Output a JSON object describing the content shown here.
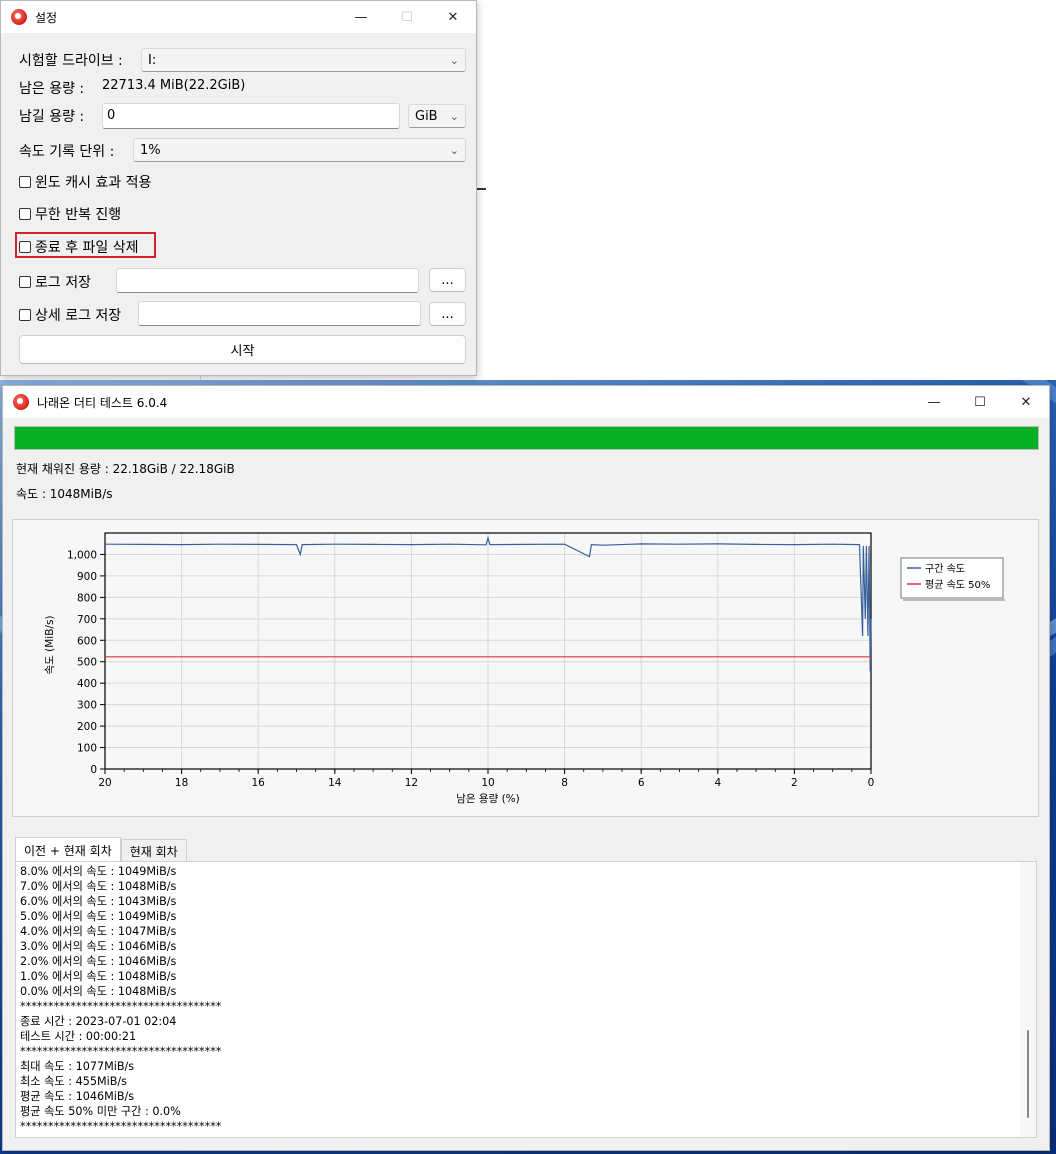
{
  "settings_window": {
    "title": "설정",
    "window_buttons": {
      "minimize": "—",
      "maximize": "☐",
      "close": "✕"
    },
    "drive_label": "시험할 드라이브 :",
    "drive_value": "I:",
    "free_space_label": "남은 용량 :",
    "free_space_value": "22713.4 MiB(22.2GiB)",
    "leave_space_label": "남길 용량 :",
    "leave_space_value": "0",
    "leave_space_unit": "GiB",
    "speed_unit_label": "속도 기록 단위 :",
    "speed_unit_value": "1%",
    "checkboxes": {
      "windows_cache": "윈도 캐시 효과 적용",
      "infinite_loop": "무한 반복 진행",
      "delete_after": "종료 후 파일 삭제",
      "save_log": "로그 저장",
      "save_detail_log": "상세 로그 저장"
    },
    "browse_label": "...",
    "start_label": "시작",
    "highlight_color": "#d6202a"
  },
  "main_window": {
    "title": "나래온 더티 테스트 6.0.4",
    "window_buttons": {
      "minimize": "—",
      "maximize": "☐",
      "close": "✕"
    },
    "progress": 1.0,
    "progress_color": "#06b025",
    "filled_text": "현재 채워진 용량 : 22.18GiB / 22.18GiB",
    "speed_text": "속도 : 1048MiB/s",
    "tabs": [
      "이전 + 현재 회차",
      "현재 회차"
    ],
    "log_lines": [
      "8.0% 에서의 속도 : 1049MiB/s",
      "7.0% 에서의 속도 : 1048MiB/s",
      "6.0% 에서의 속도 : 1043MiB/s",
      "5.0% 에서의 속도 : 1049MiB/s",
      "4.0% 에서의 속도 : 1047MiB/s",
      "3.0% 에서의 속도 : 1046MiB/s",
      "2.0% 에서의 속도 : 1046MiB/s",
      "1.0% 에서의 속도 : 1048MiB/s",
      "0.0% 에서의 속도 : 1048MiB/s",
      "************************************",
      "종료 시간 : 2023-07-01 02:04",
      "테스트 시간 : 00:00:21",
      "************************************",
      "최대 속도 : 1077MiB/s",
      "최소 속도 : 455MiB/s",
      "평균 속도 : 1046MiB/s",
      "평균 속도 50% 미만 구간 : 0.0%",
      "************************************"
    ]
  },
  "chart_data": {
    "type": "line",
    "xlabel": "남은 용량 (%)",
    "ylabel": "속도 (MiB/s)",
    "xlim": [
      20,
      0
    ],
    "ylim": [
      0,
      1100
    ],
    "xticks": [
      "20",
      "18",
      "16",
      "14",
      "12",
      "10",
      "8",
      "6",
      "4",
      "2",
      "0"
    ],
    "yticks": [
      "0",
      "100",
      "200",
      "300",
      "400",
      "500",
      "600",
      "700",
      "800",
      "900",
      "1,000"
    ],
    "grid": true,
    "legend_position": "right",
    "series": [
      {
        "name": "구간 속도",
        "color": "#3a5f9e",
        "x": [
          20,
          19,
          18,
          17,
          16,
          15,
          14.9,
          14.85,
          14,
          13,
          12,
          11,
          10.05,
          10,
          9.95,
          9,
          8,
          7.35,
          7.3,
          7,
          6,
          5,
          4,
          3,
          2,
          1,
          0.3,
          0.22,
          0.2,
          0.15,
          0.12,
          0.08,
          0.05,
          0.02,
          0
        ],
        "values": [
          1048,
          1047,
          1046,
          1048,
          1047,
          1046,
          1000,
          1046,
          1048,
          1047,
          1046,
          1048,
          1045,
          1077,
          1046,
          1047,
          1048,
          990,
          1046,
          1043,
          1049,
          1048,
          1049,
          1047,
          1046,
          1048,
          1046,
          620,
          1040,
          700,
          1040,
          620,
          1040,
          455,
          700
        ]
      },
      {
        "name": "평균 속도 50%",
        "color": "#e0303a",
        "x": [
          20,
          0
        ],
        "values": [
          523,
          523
        ]
      }
    ]
  }
}
